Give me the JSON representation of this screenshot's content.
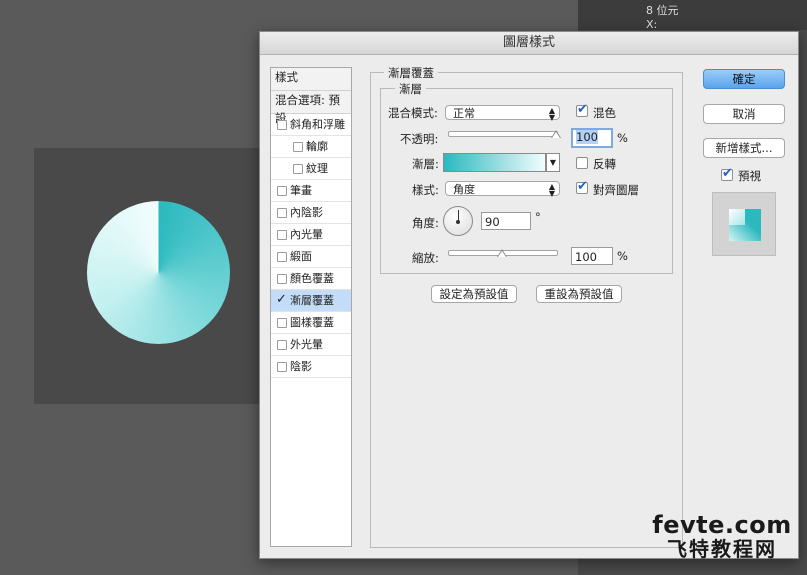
{
  "workspace": {
    "panel_labels": [
      "8 位元",
      "X:"
    ]
  },
  "dialog": {
    "title": "圖層樣式",
    "style_list": {
      "header": "樣式",
      "blend_options": "混合選項: 預設",
      "items": [
        {
          "label": "斜角和浮雕",
          "checked": false,
          "sub": false
        },
        {
          "label": "輪廓",
          "checked": false,
          "sub": true
        },
        {
          "label": "紋理",
          "checked": false,
          "sub": true
        },
        {
          "label": "筆畫",
          "checked": false,
          "sub": false
        },
        {
          "label": "內陰影",
          "checked": false,
          "sub": false
        },
        {
          "label": "內光暈",
          "checked": false,
          "sub": false
        },
        {
          "label": "緞面",
          "checked": false,
          "sub": false
        },
        {
          "label": "顏色覆蓋",
          "checked": false,
          "sub": false
        },
        {
          "label": "漸層覆蓋",
          "checked": true,
          "sub": false
        },
        {
          "label": "圖樣覆蓋",
          "checked": false,
          "sub": false
        },
        {
          "label": "外光暈",
          "checked": false,
          "sub": false
        },
        {
          "label": "陰影",
          "checked": false,
          "sub": false
        }
      ]
    },
    "gradient_overlay": {
      "section_title": "漸層覆蓋",
      "group_title": "漸層",
      "blend_mode_label": "混合模式:",
      "blend_mode_value": "正常",
      "dither_label": "混色",
      "dither_checked": true,
      "opacity_label": "不透明:",
      "opacity_value": "100",
      "opacity_fraction": 1.0,
      "percent": "%",
      "gradient_label": "漸層:",
      "gradient_start_color": "#2bb9bf",
      "gradient_end_color": "#f2fdfd",
      "reverse_label": "反轉",
      "reverse_checked": false,
      "style_label": "樣式:",
      "style_value": "角度",
      "align_label": "對齊圖層",
      "align_checked": true,
      "angle_label": "角度:",
      "angle_value": "90",
      "degree": "°",
      "scale_label": "縮放:",
      "scale_value": "100",
      "scale_fraction": 0.5,
      "make_default": "設定為預設值",
      "reset_default": "重設為預設值"
    },
    "buttons": {
      "ok": "確定",
      "cancel": "取消",
      "new_style": "新增樣式...",
      "preview_label": "預視",
      "preview_checked": true
    }
  },
  "watermark": {
    "line1": "fevte.com",
    "line2": "飞特教程网"
  }
}
